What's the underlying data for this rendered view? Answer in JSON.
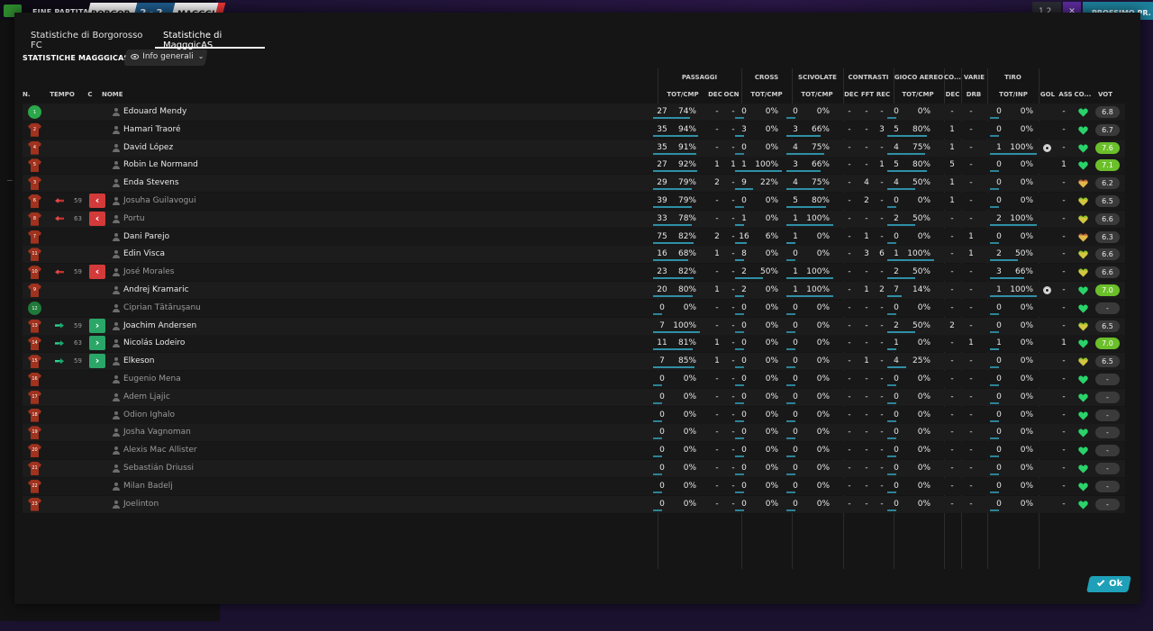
{
  "topbar": {
    "match_label": "FINE PARTITA",
    "home": "BORGOR",
    "score": "2 - 2",
    "away": "MAGGGI",
    "counter": "1 2",
    "close": "✕",
    "continue_label": "PROSSIMO PR."
  },
  "tabs": [
    {
      "label": "Statistiche di Borgorosso FC"
    },
    {
      "label": "Statistiche di MagggicAS"
    }
  ],
  "section_title": "STATISTICHE MAGGGICAS",
  "view_select": {
    "label": "Info generali"
  },
  "groups": [
    {
      "label": "PASSAGGI"
    },
    {
      "label": "CROSS"
    },
    {
      "label": "SCIVOLATE"
    },
    {
      "label": "CONTRASTI"
    },
    {
      "label": "GIOCO AEREO"
    },
    {
      "label": "CO..."
    },
    {
      "label": "VARIE"
    },
    {
      "label": "TIRO"
    }
  ],
  "headers": {
    "num": "N.",
    "time": "TEMPO",
    "c": "C",
    "name": "NOME",
    "pas": "TOT/CMP",
    "pas_dec": "DEC",
    "pas_occ": "OCN",
    "cross": "TOT/CMP",
    "sciv": "TOT/CMP",
    "con_dec": "DEC",
    "con_fft": "FFT",
    "con_rec": "REC",
    "aereo": "TOT/CMP",
    "co_dec": "DEC",
    "drb": "DRB",
    "tiro": "TOT/INP",
    "gol": "GOL",
    "ass": "ASS",
    "cond": "CO...",
    "vot": "VOT"
  },
  "players": [
    {
      "num": "1",
      "name": "Edouard Mendy",
      "gk": true,
      "pas": [
        "27",
        "74%"
      ],
      "pas_dec": "-",
      "pas_occ": "-",
      "cross": [
        "0",
        "0%"
      ],
      "sciv": [
        "0",
        "0%"
      ],
      "con_dec": "-",
      "con_fft": "-",
      "con_rec": "-",
      "aereo": [
        "0",
        "0%"
      ],
      "co_dec": "-",
      "drb": "-",
      "tiro": [
        "0",
        "0%"
      ],
      "gol": "",
      "ass": "-",
      "vot": "6.8"
    },
    {
      "num": "2",
      "name": "Hamari Traoré",
      "pas": [
        "35",
        "94%"
      ],
      "pas_dec": "-",
      "pas_occ": "-",
      "cross": [
        "3",
        "0%"
      ],
      "sciv": [
        "3",
        "66%"
      ],
      "con_dec": "-",
      "con_fft": "-",
      "con_rec": "3",
      "aereo": [
        "5",
        "80%"
      ],
      "co_dec": "1",
      "drb": "-",
      "tiro": [
        "0",
        "0%"
      ],
      "gol": "",
      "ass": "-",
      "vot": "6.7"
    },
    {
      "num": "4",
      "name": "David López",
      "pas": [
        "35",
        "91%"
      ],
      "pas_dec": "-",
      "pas_occ": "-",
      "cross": [
        "0",
        "0%"
      ],
      "sciv": [
        "4",
        "75%"
      ],
      "con_dec": "-",
      "con_fft": "-",
      "con_rec": "-",
      "aereo": [
        "4",
        "75%"
      ],
      "co_dec": "1",
      "drb": "-",
      "tiro": [
        "1",
        "100%"
      ],
      "gol": "ball",
      "ass": "-",
      "vot": "7.6",
      "hi": true
    },
    {
      "num": "5",
      "name": "Robin Le Normand",
      "pas": [
        "27",
        "92%"
      ],
      "pas_dec": "1",
      "pas_occ": "1",
      "cross": [
        "1",
        "100%"
      ],
      "sciv": [
        "3",
        "66%"
      ],
      "con_dec": "-",
      "con_fft": "-",
      "con_rec": "1",
      "aereo": [
        "5",
        "80%"
      ],
      "co_dec": "5",
      "drb": "-",
      "tiro": [
        "0",
        "0%"
      ],
      "gol": "",
      "ass": "1",
      "vot": "7.1",
      "hi": true
    },
    {
      "num": "3",
      "name": "Enda Stevens",
      "pas": [
        "29",
        "79%"
      ],
      "pas_dec": "2",
      "pas_occ": "-",
      "cross": [
        "9",
        "22%"
      ],
      "sciv": [
        "4",
        "75%"
      ],
      "con_dec": "-",
      "con_fft": "4",
      "con_rec": "-",
      "aereo": [
        "4",
        "50%"
      ],
      "co_dec": "1",
      "drb": "-",
      "tiro": [
        "0",
        "0%"
      ],
      "gol": "",
      "ass": "-",
      "vot": "6.2"
    },
    {
      "num": "6",
      "name": "Josuha Guilavogui",
      "sub": "out",
      "minute": "59",
      "pas": [
        "39",
        "79%"
      ],
      "pas_dec": "-",
      "pas_occ": "-",
      "cross": [
        "0",
        "0%"
      ],
      "sciv": [
        "5",
        "80%"
      ],
      "con_dec": "-",
      "con_fft": "2",
      "con_rec": "-",
      "aereo": [
        "0",
        "0%"
      ],
      "co_dec": "1",
      "drb": "-",
      "tiro": [
        "0",
        "0%"
      ],
      "gol": "",
      "ass": "-",
      "vot": "6.5"
    },
    {
      "num": "8",
      "name": "Portu",
      "sub": "out",
      "minute": "63",
      "pas": [
        "33",
        "78%"
      ],
      "pas_dec": "-",
      "pas_occ": "-",
      "cross": [
        "1",
        "0%"
      ],
      "sciv": [
        "1",
        "100%"
      ],
      "con_dec": "-",
      "con_fft": "-",
      "con_rec": "-",
      "aereo": [
        "2",
        "50%"
      ],
      "co_dec": "-",
      "drb": "-",
      "tiro": [
        "2",
        "100%"
      ],
      "gol": "",
      "ass": "-",
      "vot": "6.6"
    },
    {
      "num": "7",
      "name": "Dani Parejo",
      "pas": [
        "75",
        "82%"
      ],
      "pas_dec": "2",
      "pas_occ": "-",
      "cross": [
        "16",
        "6%"
      ],
      "sciv": [
        "1",
        "0%"
      ],
      "con_dec": "-",
      "con_fft": "1",
      "con_rec": "-",
      "aereo": [
        "0",
        "0%"
      ],
      "co_dec": "-",
      "drb": "1",
      "tiro": [
        "0",
        "0%"
      ],
      "gol": "",
      "ass": "-",
      "vot": "6.3"
    },
    {
      "num": "11",
      "name": "Edin Visca",
      "pas": [
        "16",
        "68%"
      ],
      "pas_dec": "1",
      "pas_occ": "-",
      "cross": [
        "8",
        "0%"
      ],
      "sciv": [
        "0",
        "0%"
      ],
      "con_dec": "-",
      "con_fft": "3",
      "con_rec": "6",
      "aereo": [
        "1",
        "100%"
      ],
      "co_dec": "-",
      "drb": "1",
      "tiro": [
        "2",
        "50%"
      ],
      "gol": "",
      "ass": "-",
      "vot": "6.6"
    },
    {
      "num": "10",
      "name": "José Morales",
      "sub": "out",
      "minute": "59",
      "pas": [
        "23",
        "82%"
      ],
      "pas_dec": "-",
      "pas_occ": "-",
      "cross": [
        "2",
        "50%"
      ],
      "sciv": [
        "1",
        "100%"
      ],
      "con_dec": "-",
      "con_fft": "-",
      "con_rec": "-",
      "aereo": [
        "2",
        "50%"
      ],
      "co_dec": "-",
      "drb": "-",
      "tiro": [
        "3",
        "66%"
      ],
      "gol": "",
      "ass": "-",
      "vot": "6.6"
    },
    {
      "num": "9",
      "name": "Andrej Kramaric",
      "pas": [
        "20",
        "80%"
      ],
      "pas_dec": "1",
      "pas_occ": "-",
      "cross": [
        "2",
        "0%"
      ],
      "sciv": [
        "1",
        "100%"
      ],
      "con_dec": "-",
      "con_fft": "1",
      "con_rec": "2",
      "aereo": [
        "7",
        "14%"
      ],
      "co_dec": "-",
      "drb": "-",
      "tiro": [
        "1",
        "100%"
      ],
      "gol": "ball",
      "ass": "-",
      "vot": "7.0",
      "hi": true
    },
    {
      "num": "12",
      "name": "Ciprian Tătăruşanu",
      "gk": true,
      "bench": true,
      "pas": [
        "0",
        "0%"
      ],
      "pas_dec": "-",
      "pas_occ": "-",
      "cross": [
        "0",
        "0%"
      ],
      "sciv": [
        "0",
        "0%"
      ],
      "con_dec": "-",
      "con_fft": "-",
      "con_rec": "-",
      "aereo": [
        "0",
        "0%"
      ],
      "co_dec": "-",
      "drb": "-",
      "tiro": [
        "0",
        "0%"
      ],
      "gol": "",
      "ass": "-",
      "vot": "-"
    },
    {
      "num": "13",
      "name": "Joachim Andersen",
      "sub": "in",
      "minute": "59",
      "pas": [
        "7",
        "100%"
      ],
      "pas_dec": "-",
      "pas_occ": "-",
      "cross": [
        "0",
        "0%"
      ],
      "sciv": [
        "0",
        "0%"
      ],
      "con_dec": "-",
      "con_fft": "-",
      "con_rec": "-",
      "aereo": [
        "2",
        "50%"
      ],
      "co_dec": "2",
      "drb": "-",
      "tiro": [
        "0",
        "0%"
      ],
      "gol": "",
      "ass": "-",
      "vot": "6.5"
    },
    {
      "num": "14",
      "name": "Nicolás Lodeiro",
      "sub": "in",
      "minute": "63",
      "pas": [
        "11",
        "81%"
      ],
      "pas_dec": "1",
      "pas_occ": "-",
      "cross": [
        "0",
        "0%"
      ],
      "sciv": [
        "0",
        "0%"
      ],
      "con_dec": "-",
      "con_fft": "-",
      "con_rec": "-",
      "aereo": [
        "1",
        "0%"
      ],
      "co_dec": "-",
      "drb": "1",
      "tiro": [
        "1",
        "0%"
      ],
      "gol": "",
      "ass": "1",
      "vot": "7.0",
      "hi": true
    },
    {
      "num": "15",
      "name": "Elkeson",
      "sub": "in",
      "minute": "59",
      "pas": [
        "7",
        "85%"
      ],
      "pas_dec": "1",
      "pas_occ": "-",
      "cross": [
        "0",
        "0%"
      ],
      "sciv": [
        "0",
        "0%"
      ],
      "con_dec": "-",
      "con_fft": "1",
      "con_rec": "-",
      "aereo": [
        "4",
        "25%"
      ],
      "co_dec": "-",
      "drb": "-",
      "tiro": [
        "0",
        "0%"
      ],
      "gol": "",
      "ass": "-",
      "vot": "6.5"
    },
    {
      "num": "16",
      "name": "Eugenio Mena",
      "bench": true,
      "pas": [
        "0",
        "0%"
      ],
      "pas_dec": "-",
      "pas_occ": "-",
      "cross": [
        "0",
        "0%"
      ],
      "sciv": [
        "0",
        "0%"
      ],
      "con_dec": "-",
      "con_fft": "-",
      "con_rec": "-",
      "aereo": [
        "0",
        "0%"
      ],
      "co_dec": "-",
      "drb": "-",
      "tiro": [
        "0",
        "0%"
      ],
      "gol": "",
      "ass": "-",
      "vot": "-"
    },
    {
      "num": "17",
      "name": "Adem Ljajic",
      "bench": true,
      "pas": [
        "0",
        "0%"
      ],
      "pas_dec": "-",
      "pas_occ": "-",
      "cross": [
        "0",
        "0%"
      ],
      "sciv": [
        "0",
        "0%"
      ],
      "con_dec": "-",
      "con_fft": "-",
      "con_rec": "-",
      "aereo": [
        "0",
        "0%"
      ],
      "co_dec": "-",
      "drb": "-",
      "tiro": [
        "0",
        "0%"
      ],
      "gol": "",
      "ass": "-",
      "vot": "-"
    },
    {
      "num": "18",
      "name": "Odion Ighalo",
      "bench": true,
      "pas": [
        "0",
        "0%"
      ],
      "pas_dec": "-",
      "pas_occ": "-",
      "cross": [
        "0",
        "0%"
      ],
      "sciv": [
        "0",
        "0%"
      ],
      "con_dec": "-",
      "con_fft": "-",
      "con_rec": "-",
      "aereo": [
        "0",
        "0%"
      ],
      "co_dec": "-",
      "drb": "-",
      "tiro": [
        "0",
        "0%"
      ],
      "gol": "",
      "ass": "-",
      "vot": "-"
    },
    {
      "num": "19",
      "name": "Josha Vagnoman",
      "bench": true,
      "pas": [
        "0",
        "0%"
      ],
      "pas_dec": "-",
      "pas_occ": "-",
      "cross": [
        "0",
        "0%"
      ],
      "sciv": [
        "0",
        "0%"
      ],
      "con_dec": "-",
      "con_fft": "-",
      "con_rec": "-",
      "aereo": [
        "0",
        "0%"
      ],
      "co_dec": "-",
      "drb": "-",
      "tiro": [
        "0",
        "0%"
      ],
      "gol": "",
      "ass": "-",
      "vot": "-"
    },
    {
      "num": "20",
      "name": "Alexis Mac Allister",
      "bench": true,
      "pas": [
        "0",
        "0%"
      ],
      "pas_dec": "-",
      "pas_occ": "-",
      "cross": [
        "0",
        "0%"
      ],
      "sciv": [
        "0",
        "0%"
      ],
      "con_dec": "-",
      "con_fft": "-",
      "con_rec": "-",
      "aereo": [
        "0",
        "0%"
      ],
      "co_dec": "-",
      "drb": "-",
      "tiro": [
        "0",
        "0%"
      ],
      "gol": "",
      "ass": "-",
      "vot": "-"
    },
    {
      "num": "21",
      "name": "Sebastián Driussi",
      "bench": true,
      "pas": [
        "0",
        "0%"
      ],
      "pas_dec": "-",
      "pas_occ": "-",
      "cross": [
        "0",
        "0%"
      ],
      "sciv": [
        "0",
        "0%"
      ],
      "con_dec": "-",
      "con_fft": "-",
      "con_rec": "-",
      "aereo": [
        "0",
        "0%"
      ],
      "co_dec": "-",
      "drb": "-",
      "tiro": [
        "0",
        "0%"
      ],
      "gol": "",
      "ass": "-",
      "vot": "-"
    },
    {
      "num": "22",
      "name": "Milan Badelj",
      "bench": true,
      "pas": [
        "0",
        "0%"
      ],
      "pas_dec": "-",
      "pas_occ": "-",
      "cross": [
        "0",
        "0%"
      ],
      "sciv": [
        "0",
        "0%"
      ],
      "con_dec": "-",
      "con_fft": "-",
      "con_rec": "-",
      "aereo": [
        "0",
        "0%"
      ],
      "co_dec": "-",
      "drb": "-",
      "tiro": [
        "0",
        "0%"
      ],
      "gol": "",
      "ass": "-",
      "vot": "-"
    },
    {
      "num": "23",
      "name": "Joelinton",
      "bench": true,
      "pas": [
        "0",
        "0%"
      ],
      "pas_dec": "-",
      "pas_occ": "-",
      "cross": [
        "0",
        "0%"
      ],
      "sciv": [
        "0",
        "0%"
      ],
      "con_dec": "-",
      "con_fft": "-",
      "con_rec": "-",
      "aereo": [
        "0",
        "0%"
      ],
      "co_dec": "-",
      "drb": "-",
      "tiro": [
        "0",
        "0%"
      ],
      "gol": "",
      "ass": "-",
      "vot": "-"
    }
  ],
  "ok_label": "Ok",
  "colors": {
    "accent": "#1ea0b8",
    "bar": "#2f8fa6",
    "rating_high": "#6bbf2a",
    "sub_out": "#d33a3a",
    "sub_in": "#2aa668",
    "shirt": "#a0321e",
    "gk": "#2aa84a"
  }
}
